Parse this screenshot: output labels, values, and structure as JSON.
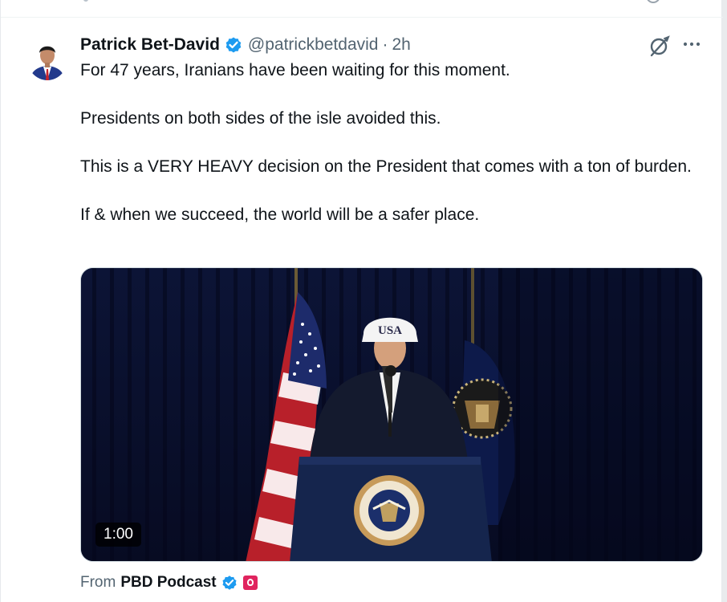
{
  "tweet": {
    "author_name": "Patrick Bet-David",
    "handle": "@patrickbetdavid",
    "separator": "·",
    "time": "2h",
    "paragraphs": [
      "For 47 years, Iranians have been waiting for this moment.",
      "Presidents on both sides of the isle avoided this.",
      "This is a VERY HEAVY decision on the President that comes with a ton of burden.",
      "If & when we succeed, the world will be a safer place."
    ],
    "media": {
      "duration": "1:00",
      "cap_text": "USA"
    },
    "source": {
      "prefix": "From",
      "name": "PBD Podcast"
    }
  },
  "icons": {
    "verified": "verified-badge-icon",
    "grok": "grok-icon",
    "more": "more-options-icon",
    "affiliate": "affiliate-badge-icon"
  },
  "colors": {
    "verified_blue": "#1d9bf0",
    "secondary_text": "#536471",
    "primary_text": "#0f1419",
    "affiliate_red": "#e0245e"
  }
}
